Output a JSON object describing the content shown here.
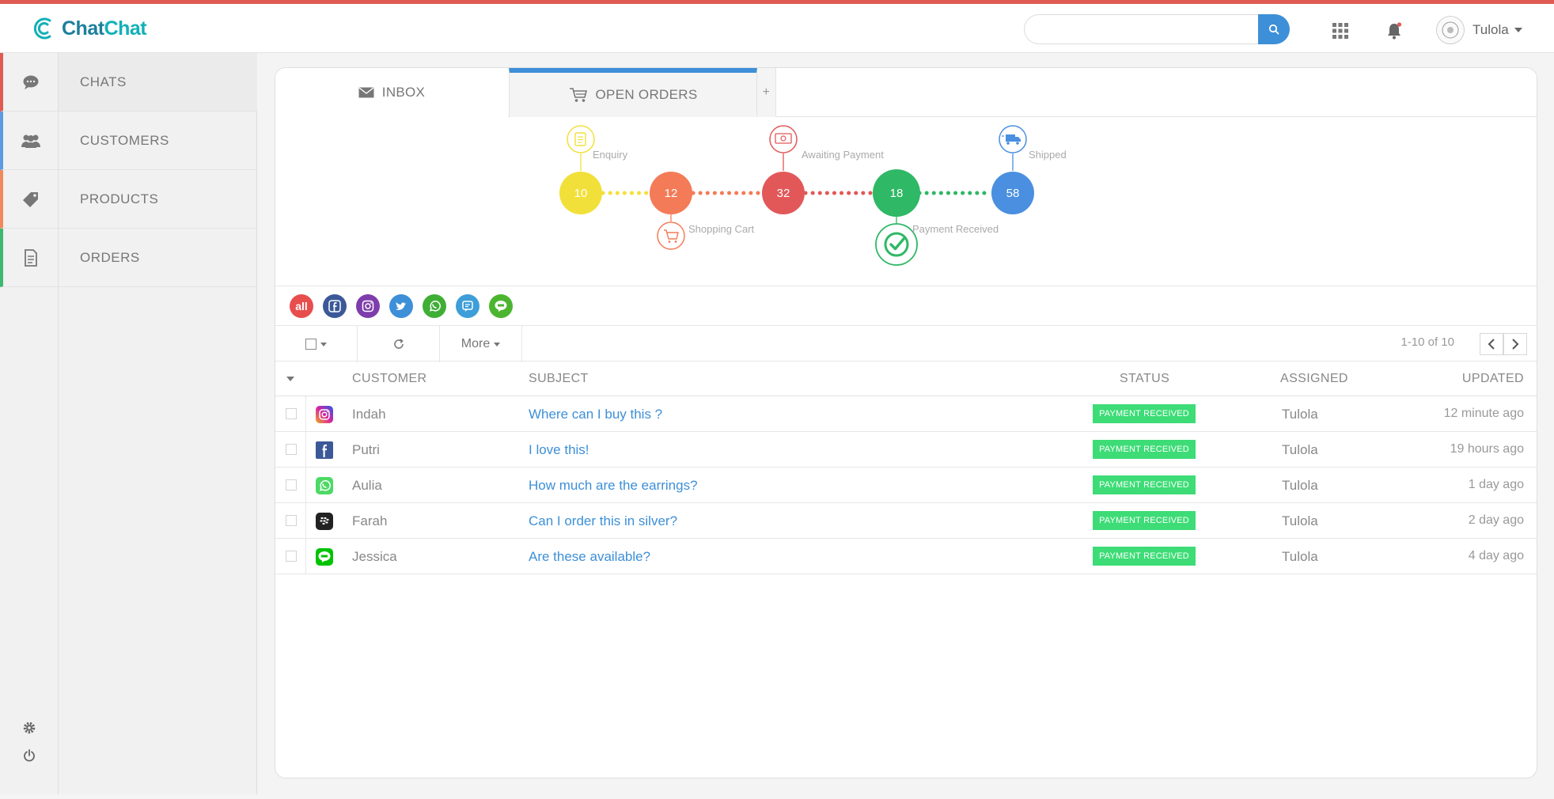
{
  "app": {
    "name_part1": "Chat",
    "name_part2": "Chat"
  },
  "header": {
    "search_placeholder": "",
    "search_value": "",
    "user_name": "Tulola"
  },
  "sidebar": {
    "items": [
      {
        "label": "CHATS",
        "icon": "chat-bubble-icon",
        "color": "#e05a54"
      },
      {
        "label": "CUSTOMERS",
        "icon": "users-icon",
        "color": "#5b9be0"
      },
      {
        "label": "PRODUCTS",
        "icon": "tag-icon",
        "color": "#f08a5d"
      },
      {
        "label": "ORDERS",
        "icon": "document-icon",
        "color": "#3db870"
      }
    ],
    "bottom": [
      {
        "icon": "gear-icon"
      },
      {
        "icon": "power-icon"
      }
    ]
  },
  "tabs": [
    {
      "label": "INBOX",
      "icon": "envelope-icon"
    },
    {
      "label": "OPEN ORDERS",
      "icon": "cart-icon",
      "active": true
    },
    {
      "label": "+"
    }
  ],
  "pipeline": {
    "stages": [
      {
        "name": "Enquiry",
        "count": "10",
        "color": "#f2e03a",
        "icon": "note-icon"
      },
      {
        "name": "Shopping Cart",
        "count": "12",
        "color": "#f47b57",
        "icon": "cart-icon"
      },
      {
        "name": "Awaiting Payment",
        "count": "32",
        "color": "#e25858",
        "icon": "money-icon"
      },
      {
        "name": "Payment Received",
        "count": "18",
        "color": "#2fb865",
        "icon": "check-circle-icon"
      },
      {
        "name": "Shipped",
        "count": "58",
        "color": "#4a8fe0",
        "icon": "truck-icon"
      }
    ]
  },
  "channels": [
    {
      "label": "all",
      "icon": "all-channels-icon",
      "color": "#e84e4e"
    },
    {
      "icon": "facebook-icon",
      "color": "#3b5998"
    },
    {
      "icon": "instagram-icon",
      "color": "#7e3dab"
    },
    {
      "icon": "twitter-icon",
      "color": "#3d8fd8"
    },
    {
      "icon": "whatsapp-icon",
      "color": "#3fae35"
    },
    {
      "icon": "chat-app-icon",
      "color": "#3d9ed8"
    },
    {
      "icon": "line-icon",
      "color": "#4cb530"
    }
  ],
  "toolbar": {
    "more_label": "More",
    "pager_info": "1-10 of 10"
  },
  "table": {
    "columns": [
      "CUSTOMER",
      "SUBJECT",
      "STATUS",
      "ASSIGNED",
      "UPDATED"
    ],
    "rows": [
      {
        "source": "instagram-icon",
        "customer": "Indah",
        "subject": "Where can I buy this ?",
        "status": "PAYMENT RECEIVED",
        "assigned": "Tulola",
        "updated": "12 minute ago"
      },
      {
        "source": "facebook-icon",
        "customer": "Putri",
        "subject": "I love this!",
        "status": "PAYMENT RECEIVED",
        "assigned": "Tulola",
        "updated": "19 hours ago"
      },
      {
        "source": "whatsapp-icon",
        "customer": "Aulia",
        "subject": "How much are the earrings?",
        "status": "PAYMENT RECEIVED",
        "assigned": "Tulola",
        "updated": "1 day ago"
      },
      {
        "source": "blackberry-icon",
        "customer": "Farah",
        "subject": "Can I order this in silver?",
        "status": "PAYMENT RECEIVED",
        "assigned": "Tulola",
        "updated": "2 day ago"
      },
      {
        "source": "line-icon",
        "customer": "Jessica",
        "subject": "Are these available?",
        "status": "PAYMENT RECEIVED",
        "assigned": "Tulola",
        "updated": "4 day ago"
      }
    ]
  }
}
